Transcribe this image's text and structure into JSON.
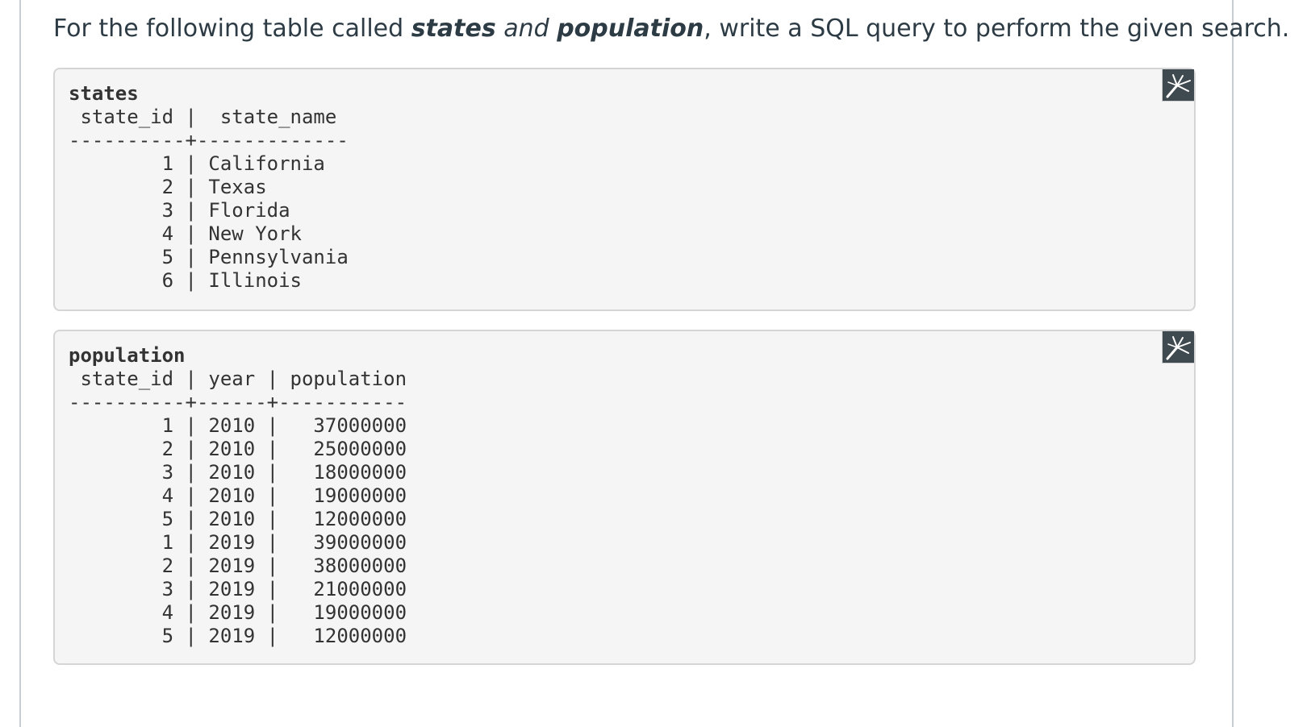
{
  "question": {
    "prefix": "For the following table called ",
    "table1": "states",
    "and": " and ",
    "table2": "population",
    "suffix": ",  write a SQL query to perform the given search."
  },
  "states_block": {
    "title": "states",
    "body": " state_id |  state_name\n----------+-------------\n        1 | California\n        2 | Texas\n        3 | Florida\n        4 | New York\n        5 | Pennsylvania\n        6 | Illinois",
    "tool_icon": "drawing-tool-icon"
  },
  "population_block": {
    "title": "population",
    "body": " state_id | year | population\n----------+------+-----------\n        1 | 2010 |   37000000\n        2 | 2010 |   25000000\n        3 | 2010 |   18000000\n        4 | 2010 |   19000000\n        5 | 2010 |   12000000\n        1 | 2019 |   39000000\n        2 | 2019 |   38000000\n        3 | 2019 |   21000000\n        4 | 2019 |   19000000\n        5 | 2019 |   12000000",
    "tool_icon": "drawing-tool-icon"
  },
  "colors": {
    "text": "#2d3b45",
    "panel_bg": "#f5f5f5",
    "panel_border": "#d5d5d5",
    "tool_button": "#3f4a50"
  }
}
